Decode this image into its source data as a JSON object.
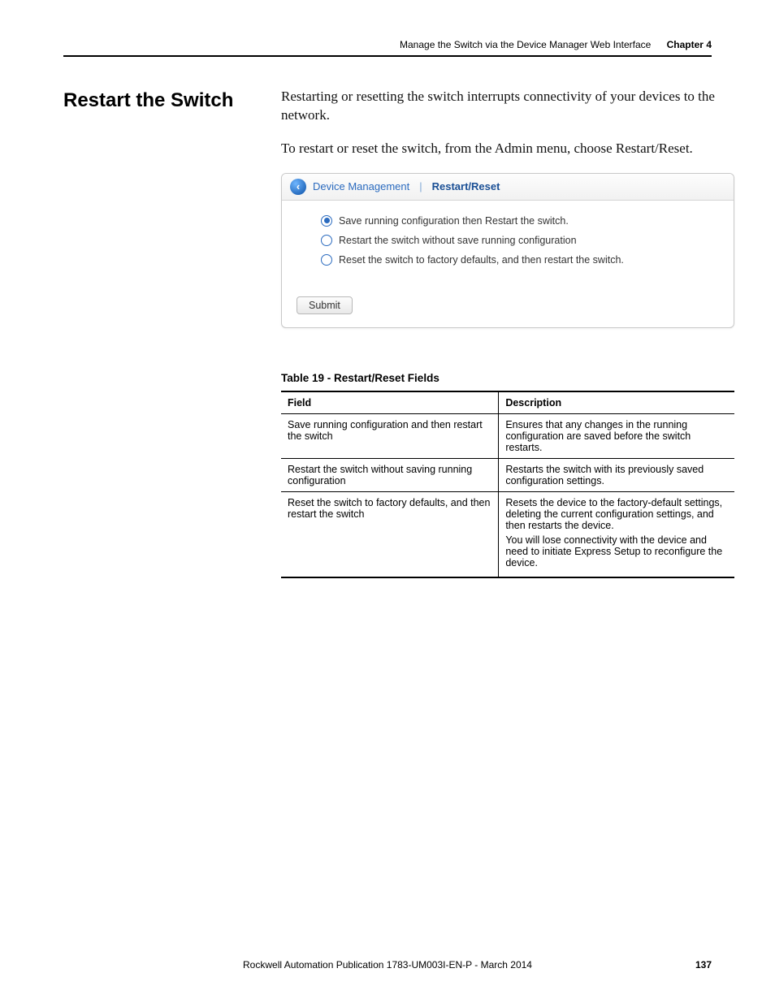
{
  "header": {
    "doc_section": "Manage the Switch via the Device Manager Web Interface",
    "chapter": "Chapter 4"
  },
  "section_title": "Restart the Switch",
  "paragraphs": {
    "p1": "Restarting or resetting the switch interrupts connectivity of your devices to the network.",
    "p2": "To restart or reset the switch, from the Admin menu, choose Restart/Reset."
  },
  "panel": {
    "back_glyph": "‹",
    "breadcrumb_parent": "Device Management",
    "breadcrumb_sep": "|",
    "breadcrumb_current": "Restart/Reset",
    "options": {
      "opt1": "Save running configuration then Restart the switch.",
      "opt2": "Restart the switch without save running configuration",
      "opt3": "Reset the switch to factory defaults, and then restart the switch."
    },
    "submit_label": "Submit"
  },
  "table": {
    "caption": "Table 19 - Restart/Reset Fields",
    "head_field": "Field",
    "head_desc": "Description",
    "rows": [
      {
        "field": "Save running configuration and then restart the switch",
        "desc": "Ensures that any changes in the running configuration are saved before the switch restarts."
      },
      {
        "field": "Restart the switch without saving running configuration",
        "desc": "Restarts the switch with its previously saved configuration settings."
      },
      {
        "field": "Reset the switch to factory defaults, and then restart the switch",
        "desc": "Resets the device to the factory-default settings, deleting the current configuration settings, and then restarts the device.",
        "desc2": "You will lose connectivity with the device and need to initiate Express Setup to reconfigure the device."
      }
    ]
  },
  "footer": {
    "pub": "Rockwell Automation Publication 1783-UM003I-EN-P - March 2014",
    "page": "137"
  }
}
